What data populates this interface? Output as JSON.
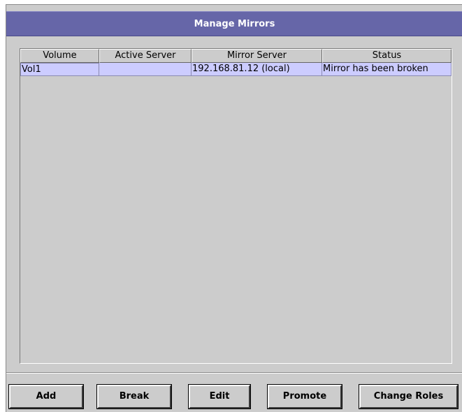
{
  "window": {
    "title": "Manage Mirrors"
  },
  "table": {
    "columns": [
      "Volume",
      "Active Server",
      "Mirror Server",
      "Status"
    ],
    "rows": [
      {
        "volume": "Vol1",
        "active_server": "",
        "mirror_server": "192.168.81.12 (local)",
        "status": "Mirror has been broken"
      }
    ]
  },
  "buttons": {
    "add": "Add",
    "break": "Break",
    "edit": "Edit",
    "promote": "Promote",
    "change_roles": "Change Roles"
  },
  "colors": {
    "title_bar": "#6666a8",
    "panel_background": "#cccccc",
    "selected_row": "#ccccff"
  }
}
